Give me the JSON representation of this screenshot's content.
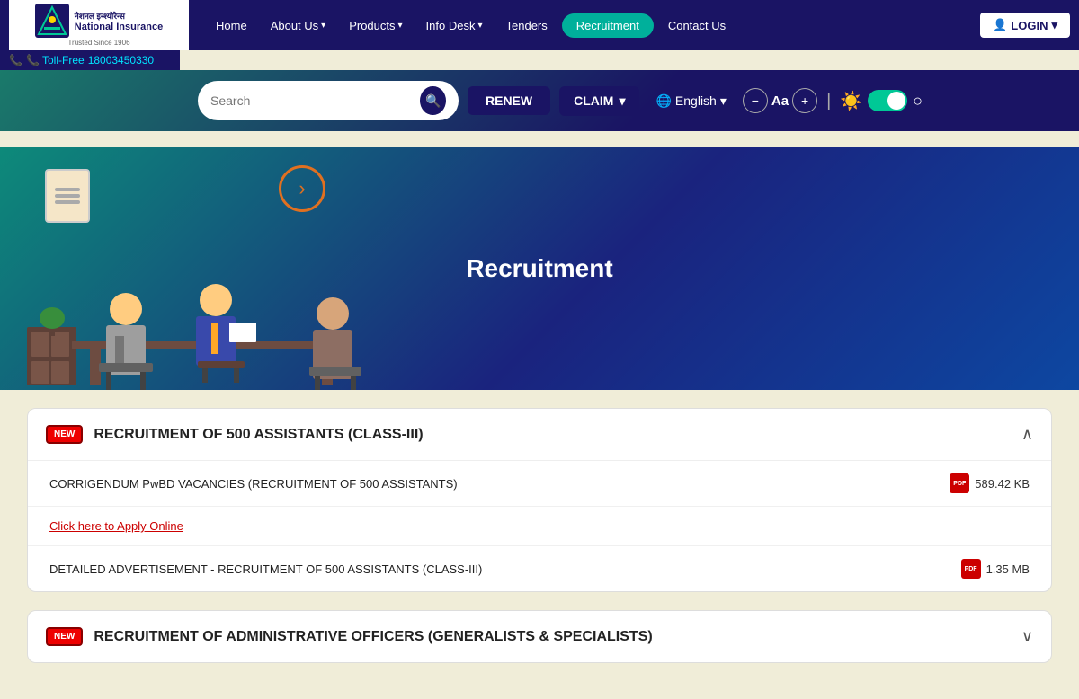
{
  "logo": {
    "hindi": "नेशनल इन्श्योरेन्स",
    "english": "National Insurance",
    "trusted": "Trusted Since 1906",
    "tollfree_label": "📞 Toll-Free",
    "tollfree_number": "18003450330"
  },
  "navbar": {
    "items": [
      {
        "label": "Home",
        "hasDropdown": false,
        "active": false
      },
      {
        "label": "About Us",
        "hasDropdown": true,
        "active": false
      },
      {
        "label": "Products",
        "hasDropdown": true,
        "active": false
      },
      {
        "label": "Info Desk",
        "hasDropdown": true,
        "active": false
      },
      {
        "label": "Tenders",
        "hasDropdown": false,
        "active": false
      },
      {
        "label": "Recruitment",
        "hasDropdown": false,
        "active": true
      },
      {
        "label": "Contact Us",
        "hasDropdown": false,
        "active": false
      }
    ],
    "login_label": "LOGIN"
  },
  "toolbar": {
    "search_placeholder": "Search",
    "renew_label": "RENEW",
    "claim_label": "CLAIM",
    "language_label": "English",
    "font_decrease": "−",
    "font_size": "Aa",
    "font_increase": "+"
  },
  "hero": {
    "title": "Recruitment"
  },
  "accordions": [
    {
      "id": "acc1",
      "badge": "NEW",
      "title": "RECRUITMENT OF 500 ASSISTANTS (CLASS-III)",
      "expanded": true,
      "rows": [
        {
          "label": "CORRIGENDUM PwBD VACANCIES (RECRUITMENT OF 500 ASSISTANTS)",
          "is_link": false,
          "size": "589.42 KB",
          "has_pdf": true
        },
        {
          "label": "Click here to Apply Online",
          "is_link": true,
          "size": "",
          "has_pdf": false
        },
        {
          "label": "DETAILED ADVERTISEMENT - RECRUITMENT OF 500 ASSISTANTS (CLASS-III)",
          "is_link": false,
          "size": "1.35 MB",
          "has_pdf": true
        }
      ]
    },
    {
      "id": "acc2",
      "badge": "NEW",
      "title": "RECRUITMENT OF ADMINISTRATIVE OFFICERS (GENERALISTS & SPECIALISTS)",
      "expanded": false,
      "rows": []
    }
  ]
}
